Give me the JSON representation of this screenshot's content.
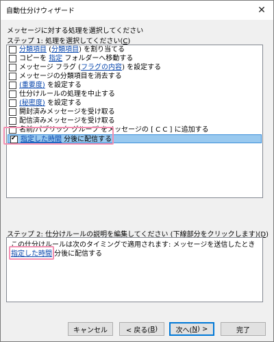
{
  "window": {
    "title": "自動仕分けウィザード",
    "close_glyph": "✕"
  },
  "header": {
    "prompt": "メッセージに対する処理を選択してください"
  },
  "step1": {
    "label_prefix": "ステップ 1: 処理を選択してください(",
    "label_key": "C",
    "label_suffix": ")",
    "items": [
      {
        "checked": false,
        "pre": "",
        "link": "分類項目",
        "mid": " (",
        "link2": "分類項目",
        "post": ") を割り当てる"
      },
      {
        "checked": false,
        "pre": "コピーを ",
        "link": "指定",
        "mid": "",
        "link2": "",
        "post": " フォルダーへ移動する"
      },
      {
        "checked": false,
        "pre": "メッセージ フラグ (",
        "link": "フラグの内容",
        "mid": "",
        "link2": "",
        "post": ") を設定する"
      },
      {
        "checked": false,
        "pre": "メッセージの分類項目を消去する",
        "link": "",
        "mid": "",
        "link2": "",
        "post": ""
      },
      {
        "checked": false,
        "pre": "",
        "link": "(重要度)",
        "mid": "",
        "link2": "",
        "post": " を設定する"
      },
      {
        "checked": false,
        "pre": "仕分けルールの処理を中止する",
        "link": "",
        "mid": "",
        "link2": "",
        "post": ""
      },
      {
        "checked": false,
        "pre": "",
        "link": "(秘密度)",
        "mid": "",
        "link2": "",
        "post": " を設定する"
      },
      {
        "checked": false,
        "pre": "開封済みメッセージを受け取る",
        "link": "",
        "mid": "",
        "link2": "",
        "post": ""
      },
      {
        "checked": false,
        "pre": "配信済みメッセージを受け取る",
        "link": "",
        "mid": "",
        "link2": "",
        "post": ""
      },
      {
        "checked": false,
        "pre": "名前/パブリック グループ をメッセージの [ C C ] に追加する",
        "link": "",
        "mid": "",
        "link2": "",
        "post": ""
      },
      {
        "checked": true,
        "pre": "",
        "link": "指定した時間",
        "mid": "",
        "link2": "",
        "post": " 分後に配信する"
      }
    ]
  },
  "step2": {
    "label_prefix": "ステップ 2: 仕分けルールの説明を編集してください (下線部分をクリックします)(",
    "label_key": "D",
    "label_suffix": ")",
    "line1": "この仕分けルールは次のタイミングで適用されます: メッセージを送信したとき",
    "line2_link": "指定した時間",
    "line2_post": " 分後に配信する"
  },
  "buttons": {
    "cancel": "キャンセル",
    "back_prefix": "< 戻る(",
    "back_key": "B",
    "back_suffix": ")",
    "next_prefix": "次へ(",
    "next_key": "N",
    "next_suffix": ") >",
    "finish": "完了"
  },
  "colors": {
    "link": "#0645ad",
    "selection": "#99c9ef",
    "annotation": "#f48fb1"
  }
}
